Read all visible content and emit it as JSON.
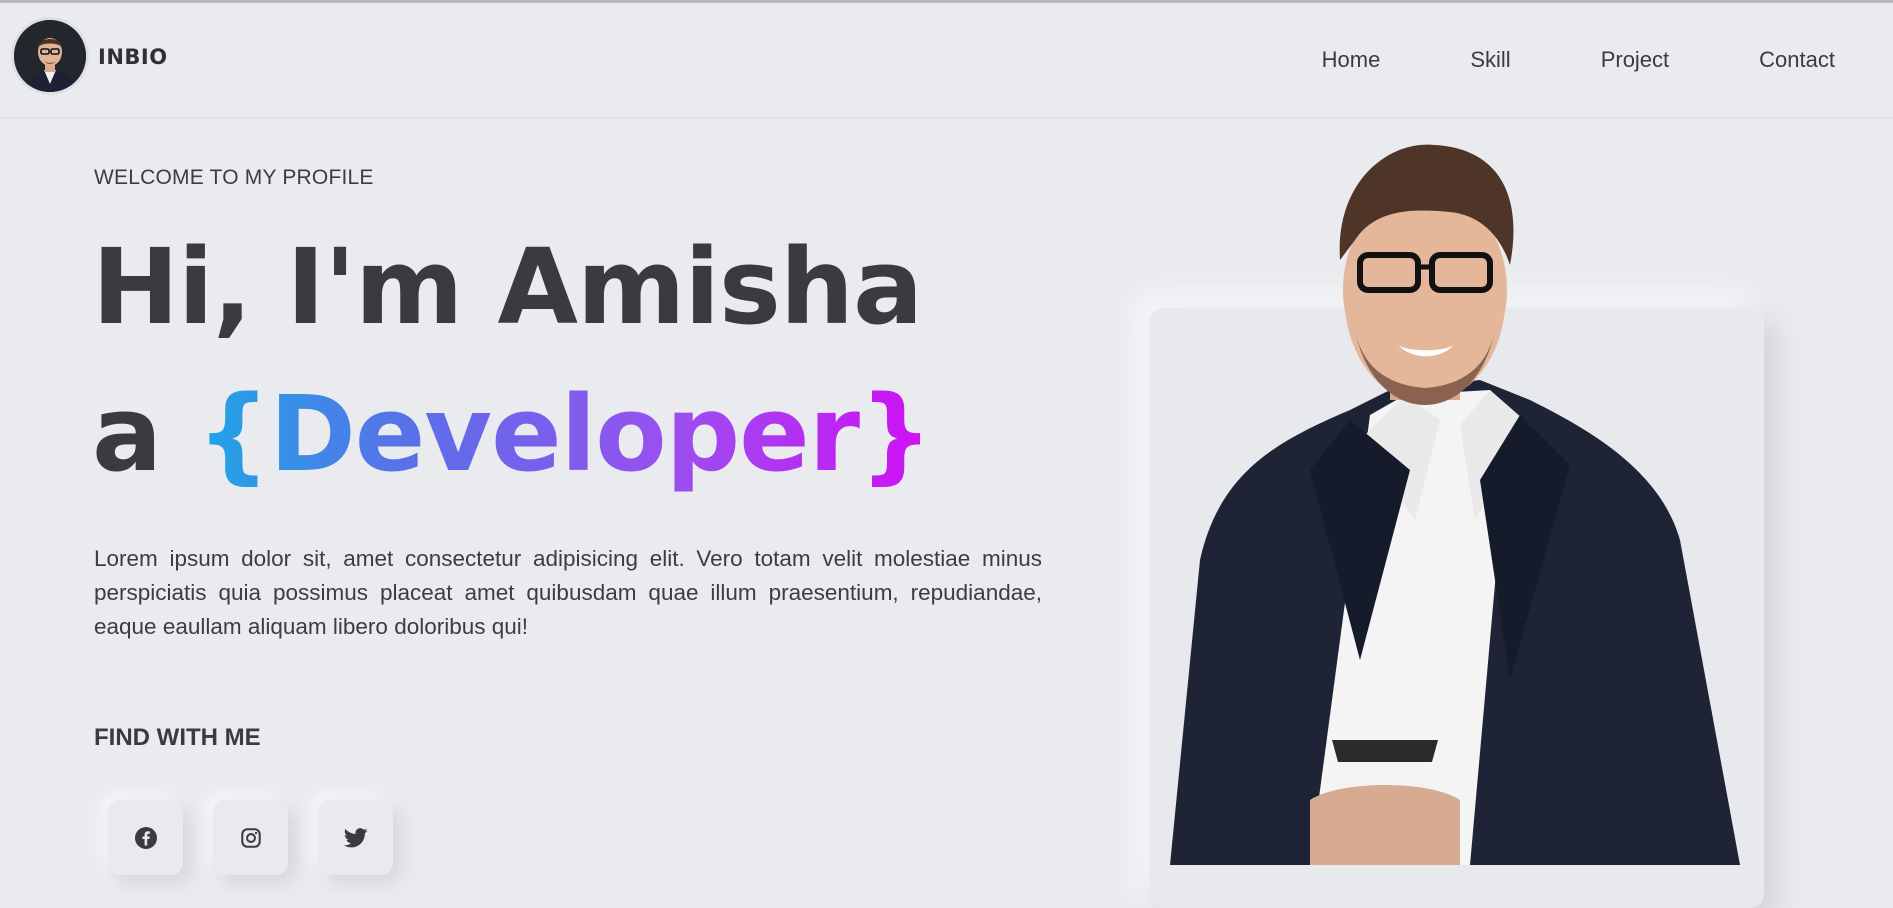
{
  "header": {
    "brand": "INBIO",
    "nav": [
      "Home",
      "Skill",
      "Project",
      "Contact"
    ]
  },
  "hero": {
    "welcome": "WELCOME TO MY PROFILE",
    "heading_line1": "Hi, I'm Amisha",
    "heading_prefix": "a",
    "heading_role": "{Developer}",
    "description": "Lorem ipsum dolor sit, amet consectetur adipisicing elit. Vero totam velit molestiae minus perspiciatis quia possimus placeat amet quibusdam quae illum praesentium, repudiandae, eaque eaullam aliquam libero doloribus qui!",
    "find_title": "FIND WITH ME"
  },
  "socials": [
    {
      "icon": "facebook-icon"
    },
    {
      "icon": "instagram-icon"
    },
    {
      "icon": "twitter-icon"
    }
  ],
  "colors": {
    "background": "#eaebee",
    "text": "#3a3b40",
    "gradient_start": "#1fa6e6",
    "gradient_end": "#d10ef5"
  }
}
